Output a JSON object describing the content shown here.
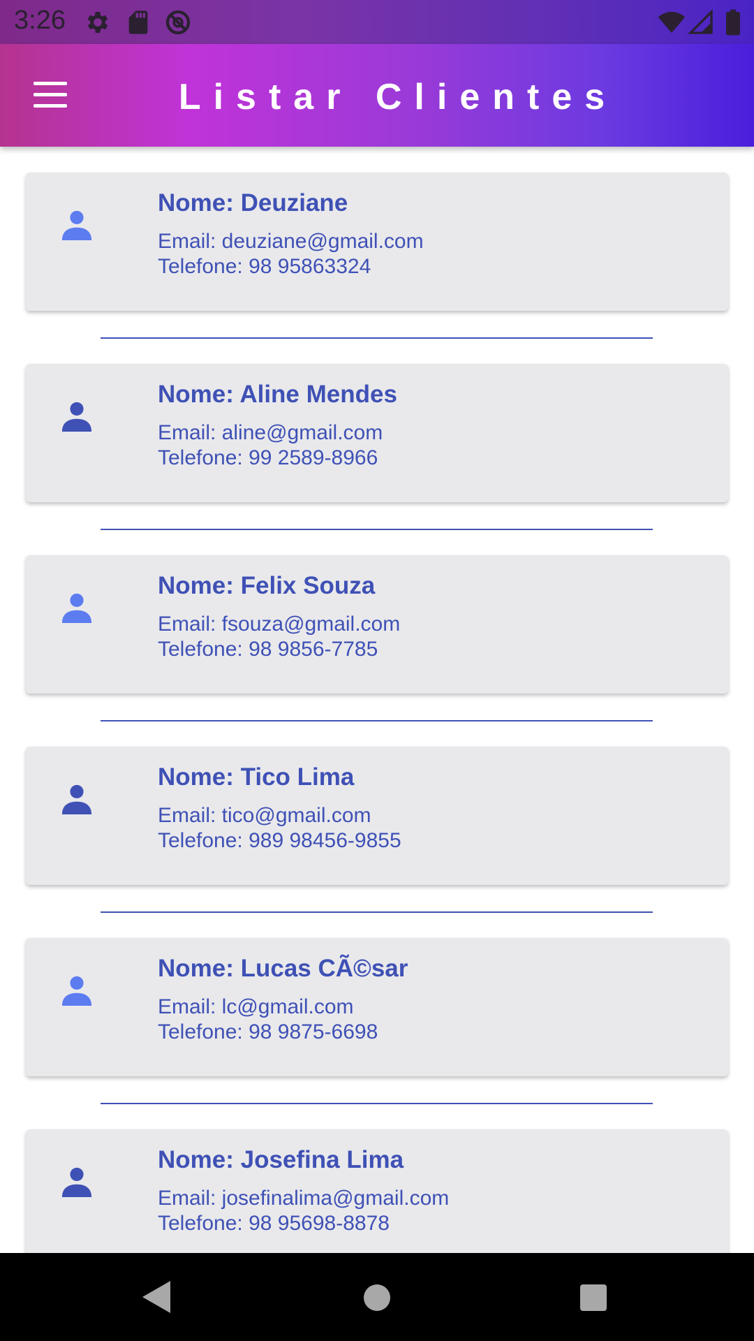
{
  "status_bar": {
    "time": "3:26",
    "left_icons": [
      "settings-icon",
      "sd-card-icon",
      "no-signal-circle-icon"
    ],
    "right_icons": [
      "wifi-icon",
      "cell-signal-icon",
      "battery-icon"
    ]
  },
  "app_bar": {
    "title": "Listar Clientes",
    "menu_icon": "hamburger-menu-icon",
    "gradient_colors": [
      "#b5338f",
      "#c033d8",
      "#6b3ae0",
      "#4a1fdc"
    ]
  },
  "colors": {
    "text_accent": "#3f51b5",
    "card_background": "#e9e9ec",
    "avatar_light": "#5c7cf0",
    "avatar_dark": "#3f51b5"
  },
  "clients": [
    {
      "name": "Nome: Deuziane",
      "email": "Email: deuziane@gmail.com",
      "phone": "Telefone: 98 95863324",
      "avatar_icon": "person-icon",
      "avatar_color": "#5c7cf0"
    },
    {
      "name": "Nome: Aline Mendes",
      "email": "Email: aline@gmail.com",
      "phone": "Telefone: 99 2589-8966",
      "avatar_icon": "person-icon",
      "avatar_color": "#3f51b5"
    },
    {
      "name": "Nome: Felix Souza",
      "email": "Email: fsouza@gmail.com",
      "phone": "Telefone: 98 9856-7785",
      "avatar_icon": "person-icon",
      "avatar_color": "#5c7cf0"
    },
    {
      "name": "Nome: Tico Lima",
      "email": "Email: tico@gmail.com",
      "phone": "Telefone: 989 98456-9855",
      "avatar_icon": "person-icon",
      "avatar_color": "#3f51b5"
    },
    {
      "name": "Nome: Lucas CÃ©sar",
      "email": "Email: lc@gmail.com",
      "phone": "Telefone: 98 9875-6698",
      "avatar_icon": "person-icon",
      "avatar_color": "#5c7cf0"
    },
    {
      "name": "Nome: Josefina Lima",
      "email": "Email: josefinalima@gmail.com",
      "phone": "Telefone: 98 95698-8878",
      "avatar_icon": "person-icon",
      "avatar_color": "#3f51b5"
    }
  ],
  "nav_bar": {
    "icons": [
      "back-icon",
      "home-icon",
      "recents-icon"
    ]
  }
}
